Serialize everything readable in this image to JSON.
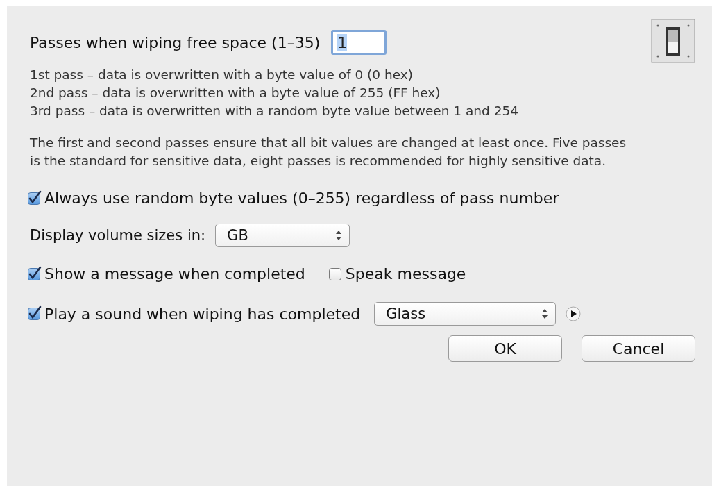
{
  "passes": {
    "label": "Passes when wiping free space (1–35)",
    "value": "1"
  },
  "pass_descriptions": [
    "1st pass – data is overwritten with a byte value of 0 (0 hex)",
    "2nd pass – data is overwritten with a byte value of 255 (FF hex)",
    "3rd pass – data is overwritten with a random byte value between 1 and 254"
  ],
  "note": "The first and second passes ensure that all bit values are changed at least once. Five passes is the standard for sensitive data, eight passes is recommended for highly sensitive data.",
  "random_bytes": {
    "label": "Always use random byte values (0–255) regardless of pass number",
    "checked": true
  },
  "volume_sizes": {
    "label": "Display volume sizes in:",
    "value": "GB"
  },
  "show_message": {
    "label": "Show a message when completed",
    "checked": true
  },
  "speak_message": {
    "label": "Speak message",
    "checked": false
  },
  "play_sound": {
    "label": "Play a sound when wiping has completed",
    "checked": true,
    "sound": "Glass"
  },
  "buttons": [
    {
      "label": "OK"
    },
    {
      "label": "Cancel"
    }
  ]
}
